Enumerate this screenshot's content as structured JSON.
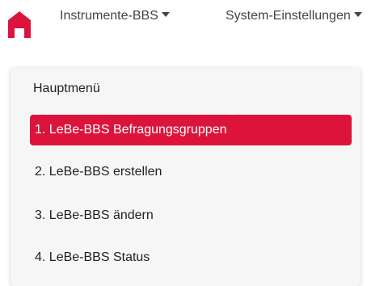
{
  "brand": {
    "accent_color": "#dc143c",
    "home_icon": "home-icon"
  },
  "nav": {
    "items": [
      {
        "label": "Instrumente-BBS"
      },
      {
        "label": "System-Einstellungen"
      }
    ]
  },
  "menu": {
    "header": "Hauptmenü",
    "items": [
      {
        "label": "1. LeBe-BBS Befragungsgruppen",
        "active": true
      },
      {
        "label": "2. LeBe-BBS erstellen",
        "active": false
      },
      {
        "label": "3. LeBe-BBS ändern",
        "active": false
      },
      {
        "label": "4. LeBe-BBS Status",
        "active": false
      }
    ]
  }
}
